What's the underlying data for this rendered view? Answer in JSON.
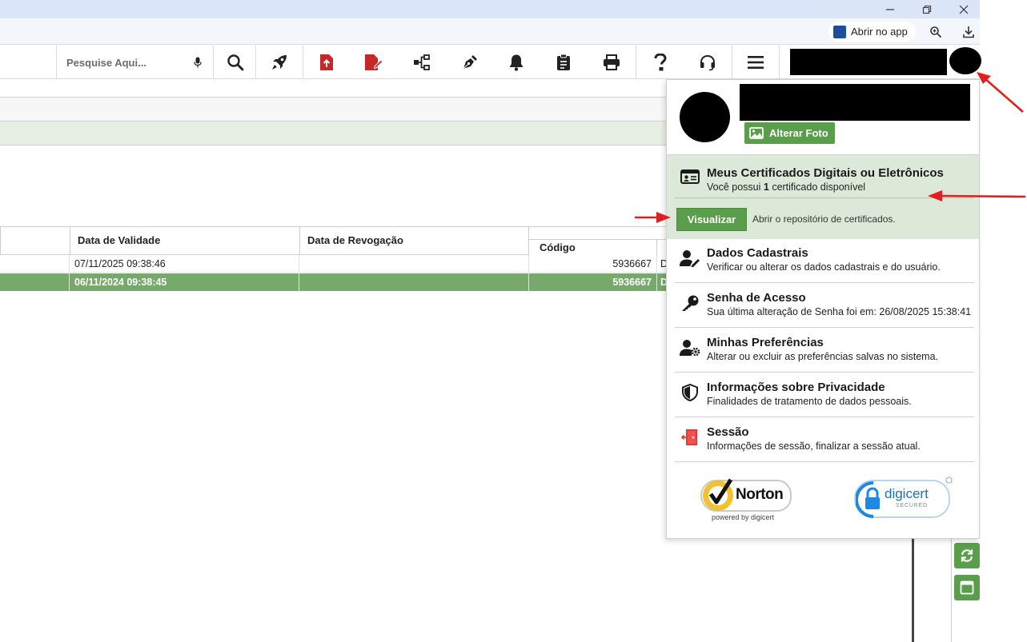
{
  "browser": {
    "open_app_label": "Abrir no app"
  },
  "toolbar": {
    "search_placeholder": "Pesquise Aqui..."
  },
  "grid": {
    "columns": [
      "Data de Validade",
      "Data de Revogação",
      "Código"
    ],
    "rows": [
      {
        "validade": "07/11/2025 09:38:46",
        "revogacao": "",
        "codigo": "5936667",
        "extra": "D",
        "selected": false
      },
      {
        "validade": "06/11/2024 09:38:45",
        "revogacao": "",
        "codigo": "5936667",
        "extra": "D",
        "selected": true
      }
    ]
  },
  "panel": {
    "change_photo_label": "Alterar Foto",
    "certificates": {
      "title": "Meus Certificados Digitais ou Eletrônicos",
      "desc_prefix": "Você possui ",
      "desc_count": "1",
      "desc_suffix": " certificado disponível",
      "view_button": "Visualizar",
      "view_desc": "Abrir o repositório de certificados."
    },
    "items": [
      {
        "title": "Dados Cadastrais",
        "desc": "Verificar ou alterar os dados cadastrais e do usuário.",
        "icon": "user-edit-icon"
      },
      {
        "title": "Senha de Acesso",
        "desc": "Sua última alteração de Senha foi em: 26/08/2025 15:38:41",
        "icon": "key-icon"
      },
      {
        "title": "Minhas Preferências",
        "desc": "Alterar ou excluir as preferências salvas no sistema.",
        "icon": "user-gear-icon"
      },
      {
        "title": "Informações sobre Privacidade",
        "desc": "Finalidades de tratamento de dados pessoais.",
        "icon": "shield-icon"
      },
      {
        "title": "Sessão",
        "desc": "Informações de sessão, finalizar a sessão atual.",
        "icon": "door-exit-icon"
      }
    ],
    "badges": {
      "norton_name": "Norton",
      "norton_sub": "powered by digicert",
      "digicert_name": "digicert",
      "digicert_sub": "SECURED"
    }
  },
  "colors": {
    "accent_green": "#5a9e4b",
    "selected_row": "#76a96a",
    "cert_box_bg": "#dde9d8",
    "annotation_arrow": "#e02020",
    "icon_red": "#c62828"
  }
}
